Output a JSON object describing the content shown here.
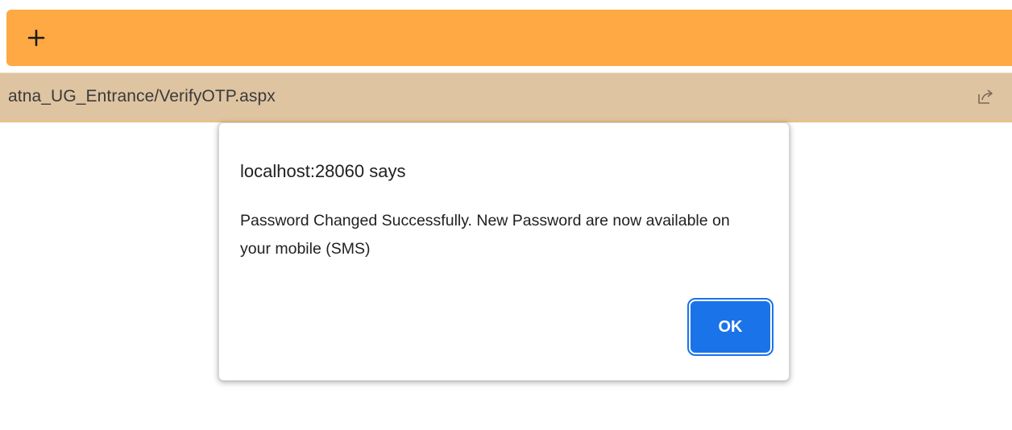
{
  "browser": {
    "new_tab_icon": "plus-icon",
    "url": "atna_UG_Entrance/VerifyOTP.aspx",
    "share_icon": "share-icon",
    "colors": {
      "tabstrip": "#fea944",
      "addressbar": "#dfc4a2"
    }
  },
  "dialog": {
    "title": "localhost:28060 says",
    "message": "Password Changed Successfully. New Password are now available on your mobile (SMS)",
    "ok_label": "OK",
    "colors": {
      "button": "#1a73e8"
    }
  }
}
